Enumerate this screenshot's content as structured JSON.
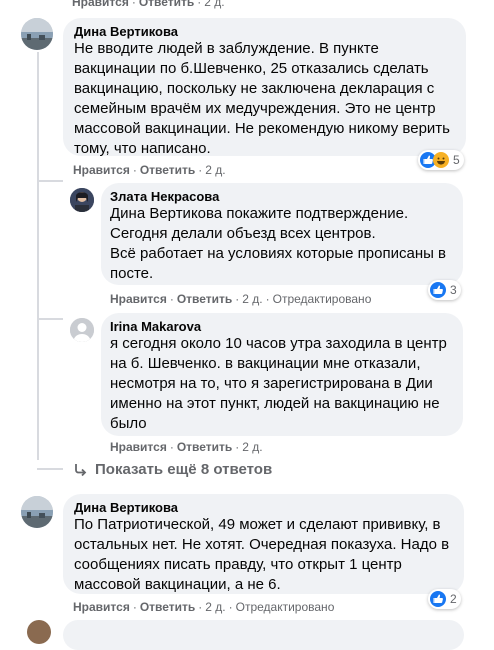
{
  "top_actions": {
    "like": "Нравится",
    "reply": "Ответить",
    "time": "2 д."
  },
  "comment1": {
    "author": "Дина Вертикова",
    "lines": [
      "Не вводите людей в заблуждение. В пункте",
      "вакцинации по б.Шевченко, 25 отказались сделать",
      "вакцинацию, поскольку не заключена декларация с",
      "семейным врачём их медучреждения. Это не центр",
      "массовой вакцинации. Не рекомендую никому верить",
      "тому, что написано."
    ],
    "like": "Нравится",
    "reply": "Ответить",
    "time": "2 д.",
    "reaction_count": "5"
  },
  "reply1": {
    "author": "Злата Некрасова",
    "lines": [
      "Дина Вертикова покажите подтверждение.",
      "Сегодня делали объезд всех центров.",
      "Всё работает на условиях которые прописаны в",
      "посте."
    ],
    "like": "Нравится",
    "reply": "Ответить",
    "time": "2 д.",
    "edited": "Отредактировано",
    "reaction_count": "3"
  },
  "reply2": {
    "author": "Irina Makarova",
    "lines": [
      "я сегодня около 10 часов утра заходила в центр",
      "на б. Шевченко. в вакцинации мне отказали,",
      "несмотря на то, что я зарегистрирована в Дии",
      "именно на этот пункт, людей на вакцинацию не",
      "было"
    ],
    "like": "Нравится",
    "reply": "Ответить",
    "time": "2 д."
  },
  "more_replies": "Показать ещё 8 ответов",
  "comment2": {
    "author": "Дина Вертикова",
    "lines": [
      "По Патриотической, 49 может и сделают прививку, в",
      "остальных нет. Не хотят. Очередная показуха. Надо в",
      "сообщениях писать правду, что открыт 1 центр",
      "массовой вакцинации, а не 6."
    ],
    "like": "Нравится",
    "reply": "Ответить",
    "time": "2 д.",
    "edited": "Отредактировано",
    "reaction_count": "2"
  },
  "colors": {
    "bubble": "#f0f2f5",
    "muted": "#65676b",
    "like_blue": "#1877f2",
    "love_red": "#f33e58",
    "haha_yellow": "#f7b125"
  }
}
